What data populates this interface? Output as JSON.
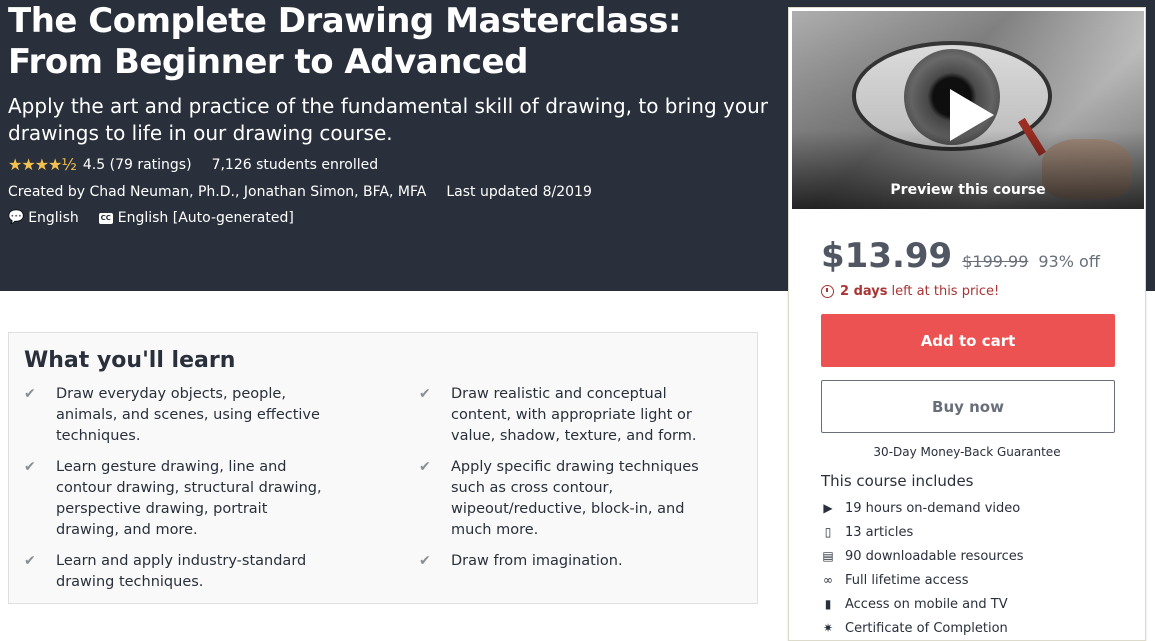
{
  "course": {
    "title": "The Complete Drawing Masterclass: From Beginner to Advanced",
    "subtitle": "Apply the art and practice of the fundamental skill of drawing, to bring your drawings to life in our drawing course.",
    "rating_value": "4.5",
    "rating_count": "(79 ratings)",
    "rating_fraction": 0.9,
    "students": "7,126 students enrolled",
    "created_by": "Created by Chad Neuman, Ph.D., Jonathan Simon, BFA, MFA",
    "last_updated": "Last updated 8/2019",
    "language": "English",
    "captions": "English [Auto-generated]",
    "cc_icon": "CC"
  },
  "preview": {
    "label": "Preview this course"
  },
  "pricing": {
    "price": "$13.99",
    "original_price": "$199.99",
    "discount": "93% off",
    "timer_days": "2 days",
    "timer_rest": "left at this price!",
    "add_to_cart": "Add to cart",
    "buy_now": "Buy now",
    "guarantee": "30-Day Money-Back Guarantee"
  },
  "includes": {
    "title": "This course includes",
    "items": [
      {
        "icon": "video-icon",
        "glyph": "▶",
        "label": "19 hours on-demand video"
      },
      {
        "icon": "file-icon",
        "glyph": "▯",
        "label": "13 articles"
      },
      {
        "icon": "download-icon",
        "glyph": "▤",
        "label": "90 downloadable resources"
      },
      {
        "icon": "infinity-icon",
        "glyph": "∞",
        "label": "Full lifetime access"
      },
      {
        "icon": "mobile-icon",
        "glyph": "▮",
        "label": "Access on mobile and TV"
      },
      {
        "icon": "certificate-icon",
        "glyph": "✷",
        "label": "Certificate of Completion"
      }
    ]
  },
  "learn": {
    "title": "What you'll learn",
    "left": [
      "Draw everyday objects, people, animals, and scenes, using effective techniques.",
      "Learn gesture drawing, line and contour drawing, structural drawing, perspective drawing, portrait drawing, and more.",
      "Learn and apply industry-standard drawing techniques."
    ],
    "right": [
      "Draw realistic and conceptual content, with appropriate light or value, shadow, texture, and form.",
      "Apply specific drawing techniques such as cross contour, wipeout/reductive, block-in, and much more.",
      "Draw from imagination."
    ]
  },
  "colors": {
    "hero_bg": "#29303b",
    "accent_red": "#ec5252",
    "star": "#f4c150",
    "timer": "#a33333"
  }
}
